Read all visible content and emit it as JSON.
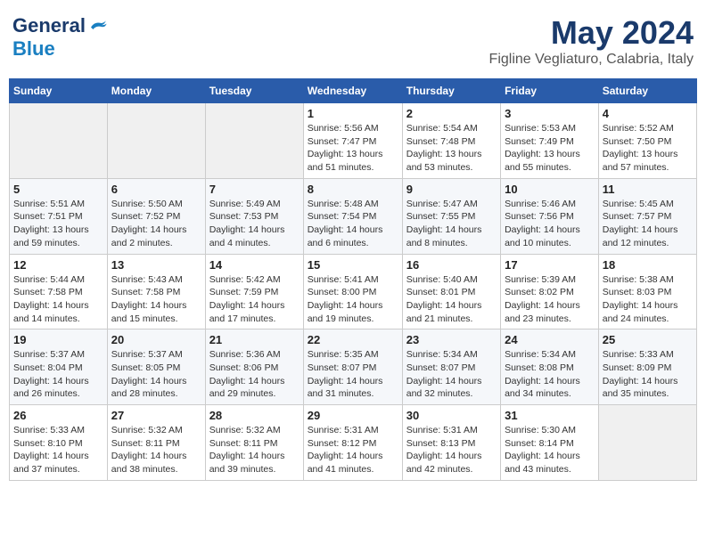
{
  "header": {
    "logo_general": "General",
    "logo_blue": "Blue",
    "month_title": "May 2024",
    "location": "Figline Vegliaturo, Calabria, Italy"
  },
  "days_of_week": [
    "Sunday",
    "Monday",
    "Tuesday",
    "Wednesday",
    "Thursday",
    "Friday",
    "Saturday"
  ],
  "weeks": [
    [
      {
        "day": "",
        "info": ""
      },
      {
        "day": "",
        "info": ""
      },
      {
        "day": "",
        "info": ""
      },
      {
        "day": "1",
        "info": "Sunrise: 5:56 AM\nSunset: 7:47 PM\nDaylight: 13 hours\nand 51 minutes."
      },
      {
        "day": "2",
        "info": "Sunrise: 5:54 AM\nSunset: 7:48 PM\nDaylight: 13 hours\nand 53 minutes."
      },
      {
        "day": "3",
        "info": "Sunrise: 5:53 AM\nSunset: 7:49 PM\nDaylight: 13 hours\nand 55 minutes."
      },
      {
        "day": "4",
        "info": "Sunrise: 5:52 AM\nSunset: 7:50 PM\nDaylight: 13 hours\nand 57 minutes."
      }
    ],
    [
      {
        "day": "5",
        "info": "Sunrise: 5:51 AM\nSunset: 7:51 PM\nDaylight: 13 hours\nand 59 minutes."
      },
      {
        "day": "6",
        "info": "Sunrise: 5:50 AM\nSunset: 7:52 PM\nDaylight: 14 hours\nand 2 minutes."
      },
      {
        "day": "7",
        "info": "Sunrise: 5:49 AM\nSunset: 7:53 PM\nDaylight: 14 hours\nand 4 minutes."
      },
      {
        "day": "8",
        "info": "Sunrise: 5:48 AM\nSunset: 7:54 PM\nDaylight: 14 hours\nand 6 minutes."
      },
      {
        "day": "9",
        "info": "Sunrise: 5:47 AM\nSunset: 7:55 PM\nDaylight: 14 hours\nand 8 minutes."
      },
      {
        "day": "10",
        "info": "Sunrise: 5:46 AM\nSunset: 7:56 PM\nDaylight: 14 hours\nand 10 minutes."
      },
      {
        "day": "11",
        "info": "Sunrise: 5:45 AM\nSunset: 7:57 PM\nDaylight: 14 hours\nand 12 minutes."
      }
    ],
    [
      {
        "day": "12",
        "info": "Sunrise: 5:44 AM\nSunset: 7:58 PM\nDaylight: 14 hours\nand 14 minutes."
      },
      {
        "day": "13",
        "info": "Sunrise: 5:43 AM\nSunset: 7:58 PM\nDaylight: 14 hours\nand 15 minutes."
      },
      {
        "day": "14",
        "info": "Sunrise: 5:42 AM\nSunset: 7:59 PM\nDaylight: 14 hours\nand 17 minutes."
      },
      {
        "day": "15",
        "info": "Sunrise: 5:41 AM\nSunset: 8:00 PM\nDaylight: 14 hours\nand 19 minutes."
      },
      {
        "day": "16",
        "info": "Sunrise: 5:40 AM\nSunset: 8:01 PM\nDaylight: 14 hours\nand 21 minutes."
      },
      {
        "day": "17",
        "info": "Sunrise: 5:39 AM\nSunset: 8:02 PM\nDaylight: 14 hours\nand 23 minutes."
      },
      {
        "day": "18",
        "info": "Sunrise: 5:38 AM\nSunset: 8:03 PM\nDaylight: 14 hours\nand 24 minutes."
      }
    ],
    [
      {
        "day": "19",
        "info": "Sunrise: 5:37 AM\nSunset: 8:04 PM\nDaylight: 14 hours\nand 26 minutes."
      },
      {
        "day": "20",
        "info": "Sunrise: 5:37 AM\nSunset: 8:05 PM\nDaylight: 14 hours\nand 28 minutes."
      },
      {
        "day": "21",
        "info": "Sunrise: 5:36 AM\nSunset: 8:06 PM\nDaylight: 14 hours\nand 29 minutes."
      },
      {
        "day": "22",
        "info": "Sunrise: 5:35 AM\nSunset: 8:07 PM\nDaylight: 14 hours\nand 31 minutes."
      },
      {
        "day": "23",
        "info": "Sunrise: 5:34 AM\nSunset: 8:07 PM\nDaylight: 14 hours\nand 32 minutes."
      },
      {
        "day": "24",
        "info": "Sunrise: 5:34 AM\nSunset: 8:08 PM\nDaylight: 14 hours\nand 34 minutes."
      },
      {
        "day": "25",
        "info": "Sunrise: 5:33 AM\nSunset: 8:09 PM\nDaylight: 14 hours\nand 35 minutes."
      }
    ],
    [
      {
        "day": "26",
        "info": "Sunrise: 5:33 AM\nSunset: 8:10 PM\nDaylight: 14 hours\nand 37 minutes."
      },
      {
        "day": "27",
        "info": "Sunrise: 5:32 AM\nSunset: 8:11 PM\nDaylight: 14 hours\nand 38 minutes."
      },
      {
        "day": "28",
        "info": "Sunrise: 5:32 AM\nSunset: 8:11 PM\nDaylight: 14 hours\nand 39 minutes."
      },
      {
        "day": "29",
        "info": "Sunrise: 5:31 AM\nSunset: 8:12 PM\nDaylight: 14 hours\nand 41 minutes."
      },
      {
        "day": "30",
        "info": "Sunrise: 5:31 AM\nSunset: 8:13 PM\nDaylight: 14 hours\nand 42 minutes."
      },
      {
        "day": "31",
        "info": "Sunrise: 5:30 AM\nSunset: 8:14 PM\nDaylight: 14 hours\nand 43 minutes."
      },
      {
        "day": "",
        "info": ""
      }
    ]
  ]
}
